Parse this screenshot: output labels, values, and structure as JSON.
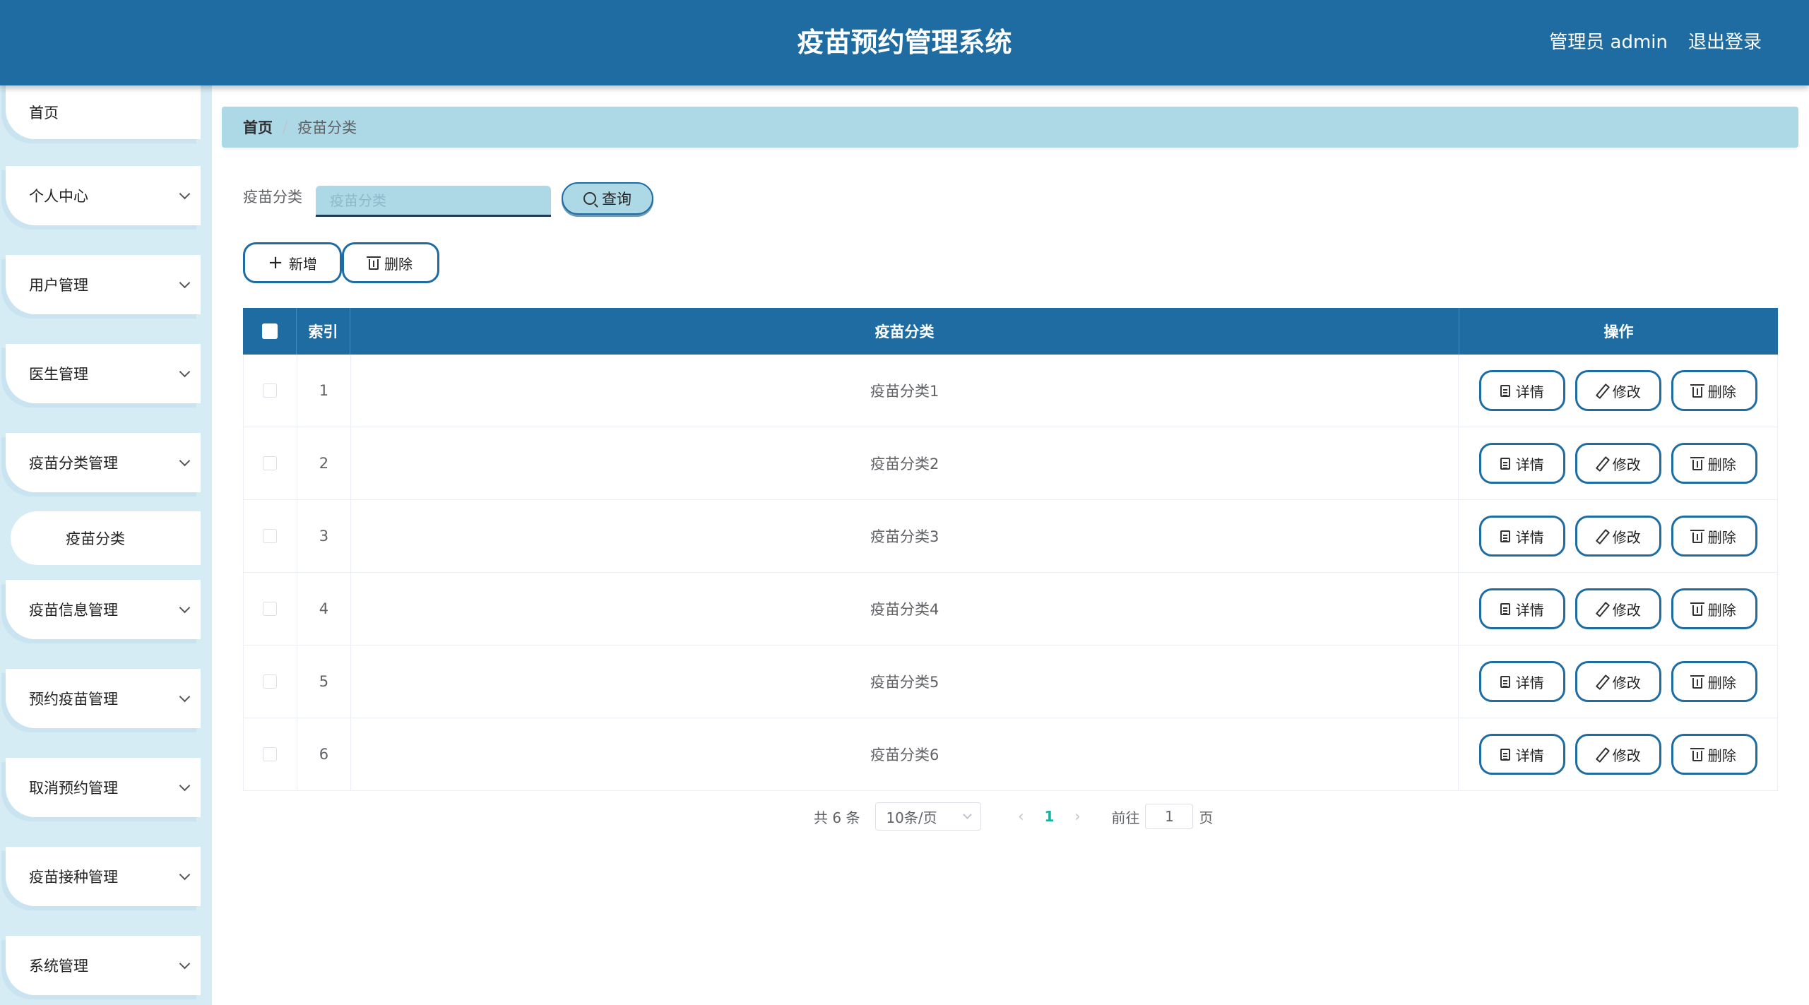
{
  "header": {
    "title": "疫苗预约管理系统",
    "user": "管理员 admin",
    "logout": "退出登录"
  },
  "sidebar": {
    "items": [
      {
        "label": "首页"
      },
      {
        "label": "个人中心"
      },
      {
        "label": "用户管理"
      },
      {
        "label": "医生管理"
      },
      {
        "label": "疫苗分类管理"
      },
      {
        "label": "疫苗信息管理"
      },
      {
        "label": "预约疫苗管理"
      },
      {
        "label": "取消预约管理"
      },
      {
        "label": "疫苗接种管理"
      },
      {
        "label": "系统管理"
      }
    ],
    "active_sub": "疫苗分类"
  },
  "breadcrumb": {
    "home": "首页",
    "separator": "/",
    "current": "疫苗分类"
  },
  "search": {
    "label": "疫苗分类",
    "placeholder": "疫苗分类",
    "value": "",
    "button": "查询"
  },
  "toolbar": {
    "add": "新增",
    "delete": "删除"
  },
  "table": {
    "columns": {
      "index": "索引",
      "name": "疫苗分类",
      "ops": "操作"
    },
    "rows": [
      {
        "index": "1",
        "name": "疫苗分类1"
      },
      {
        "index": "2",
        "name": "疫苗分类2"
      },
      {
        "index": "3",
        "name": "疫苗分类3"
      },
      {
        "index": "4",
        "name": "疫苗分类4"
      },
      {
        "index": "5",
        "name": "疫苗分类5"
      },
      {
        "index": "6",
        "name": "疫苗分类6"
      }
    ],
    "actions": {
      "detail": "详情",
      "edit": "修改",
      "delete": "删除"
    }
  },
  "pagination": {
    "total": "共 6 条",
    "page_size": "10条/页",
    "prev": "‹",
    "current": "1",
    "next": "›",
    "goto_label": "前往",
    "goto_value": "1",
    "page_suffix": "页"
  },
  "colors": {
    "primary": "#1e6ca2",
    "light_blue": "#add8e6",
    "sidebar_bg": "#d6ecf5",
    "pager_active": "#16b2a2"
  }
}
